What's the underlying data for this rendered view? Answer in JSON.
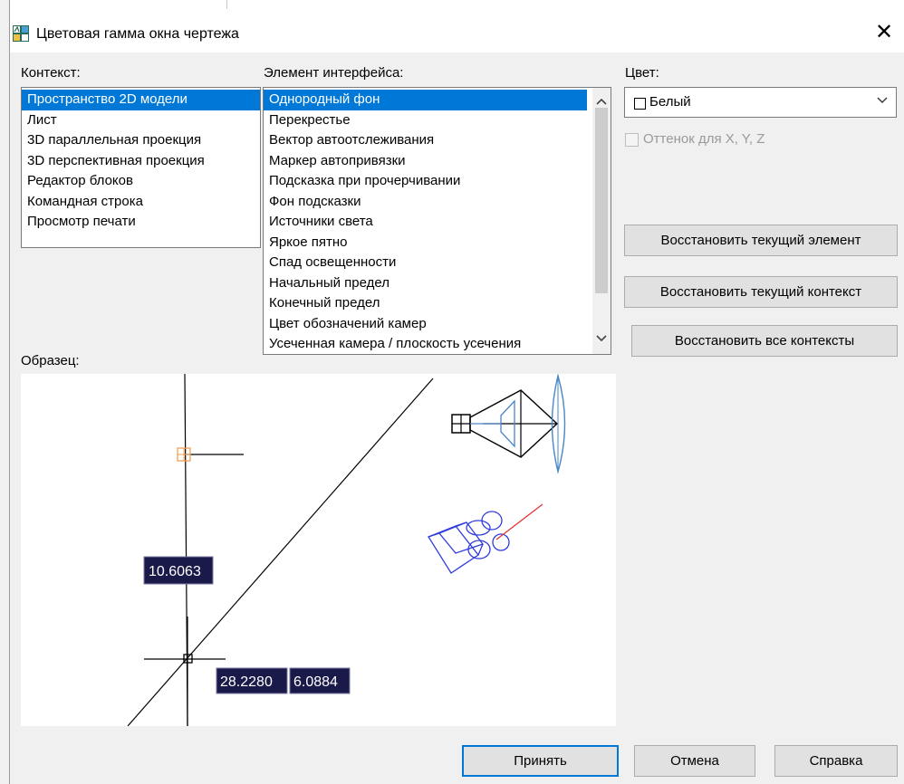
{
  "window": {
    "title": "Цветовая гамма окна чертежа",
    "close_glyph": "✕"
  },
  "context": {
    "label": "Контекст:",
    "items": [
      "Пространство 2D модели",
      "Лист",
      "3D параллельная проекция",
      "3D перспективная проекция",
      "Редактор блоков",
      "Командная строка",
      "Просмотр печати"
    ],
    "selected": "Пространство 2D модели"
  },
  "interface": {
    "label": "Элемент интерфейса:",
    "items": [
      "Однородный фон",
      "Перекрестье",
      "Вектор автоотслеживания",
      "Маркер автопривязки",
      "Подсказка при прочерчивании",
      "Фон подсказки",
      "Источники света",
      "Яркое пятно",
      "Спад освещенности",
      "Начальный предел",
      "Конечный предел",
      "Цвет обозначений камер",
      "Усеченная камера / плоскость усечения"
    ],
    "selected": "Однородный фон"
  },
  "color": {
    "label": "Цвет:",
    "value": "Белый",
    "swatch_color": "#ffffff"
  },
  "tint": {
    "label": "Оттенок для X, Y, Z",
    "checked": false,
    "enabled": false
  },
  "buttons": {
    "restore_element": "Восстановить текущий элемент",
    "restore_context": "Восстановить текущий контекст",
    "restore_all": "Восстановить все контексты",
    "ok": "Принять",
    "cancel": "Отмена",
    "help": "Справка"
  },
  "preview": {
    "label": "Образец:",
    "tooltip_value": "10.6063",
    "coord_x": "28.2280",
    "coord_y": "6.0884",
    "colors": {
      "geometry": "#000000",
      "light": "#4a86c8",
      "camera": "#2f3cdc",
      "marker": "#f0a050",
      "ray": "#e03030",
      "tooltip_bg": "#1a1a4a",
      "tooltip_text": "#ffffff"
    }
  },
  "icons": {
    "app": "cad-app-icon",
    "combo_arrow": "chevron-down-icon",
    "scroll_up": "chevron-up-icon",
    "scroll_down": "chevron-down-icon",
    "close": "close-icon"
  },
  "accent": "#0078d7"
}
